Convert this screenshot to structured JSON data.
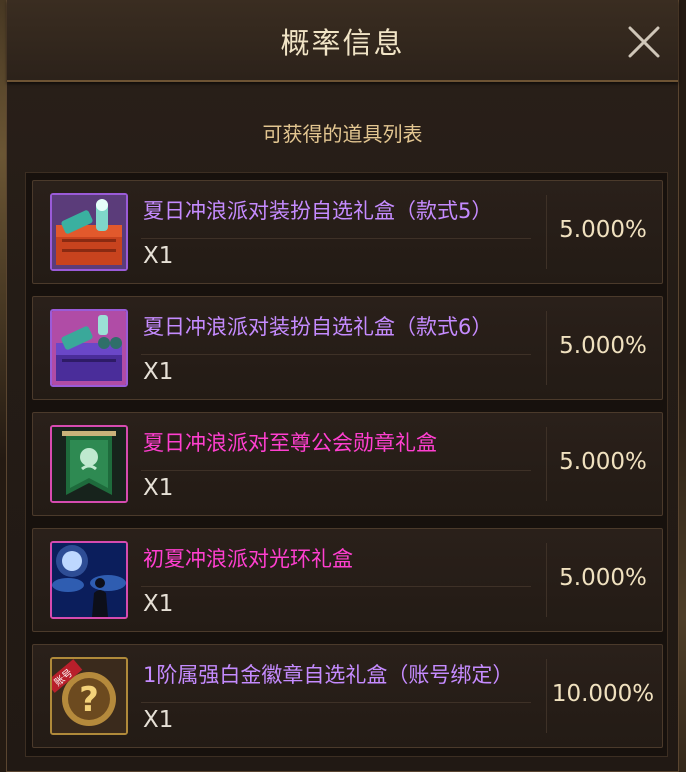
{
  "dialog": {
    "title": "概率信息",
    "subtitle": "可获得的道具列表"
  },
  "items": [
    {
      "name": "夏日冲浪派对装扮自选礼盒（款式5）",
      "qty": "X1",
      "probability": "5.000%",
      "name_color": "#c58bff",
      "icon": "beach-gift-box-red-icon"
    },
    {
      "name": "夏日冲浪派对装扮自选礼盒（款式6）",
      "qty": "X1",
      "probability": "5.000%",
      "name_color": "#c58bff",
      "icon": "beach-gift-box-purple-icon"
    },
    {
      "name": "夏日冲浪派对至尊公会勋章礼盒",
      "qty": "X1",
      "probability": "5.000%",
      "name_color": "#ff3fd0",
      "icon": "guild-banner-icon"
    },
    {
      "name": "初夏冲浪派对光环礼盒",
      "qty": "X1",
      "probability": "5.000%",
      "name_color": "#ff3fd0",
      "icon": "night-aura-icon"
    },
    {
      "name": "1阶属强白金徽章自选礼盒（账号绑定）",
      "qty": "X1",
      "probability": "10.000%",
      "name_color": "#c58bff",
      "icon": "mystery-badge-icon",
      "icon_tag": "账号"
    }
  ]
}
